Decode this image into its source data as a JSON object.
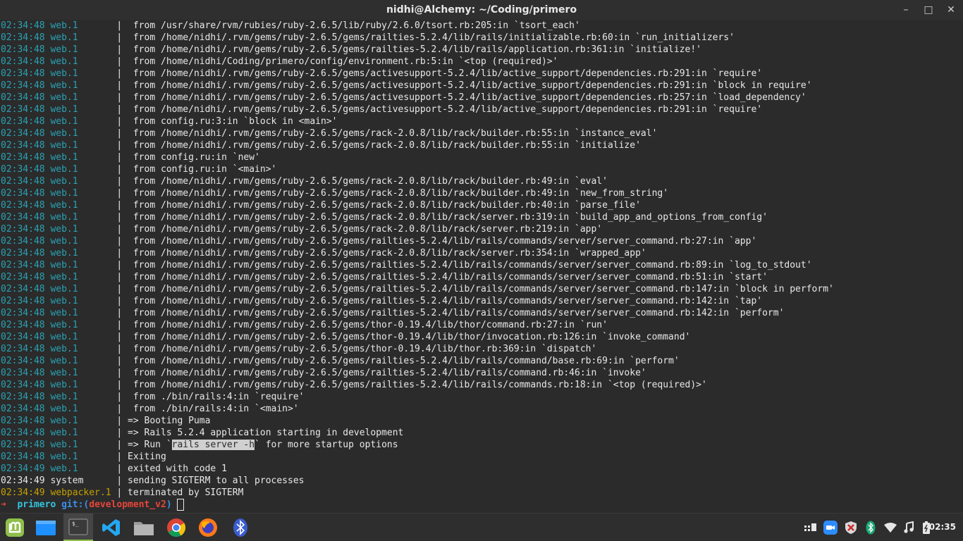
{
  "window": {
    "title": "nidhi@Alchemy: ~/Coding/primero",
    "controls": {
      "minimize": "–",
      "maximize": "□",
      "close": "✕"
    }
  },
  "terminal": {
    "lines": [
      {
        "ts": "02:34:48 web.1",
        "proc": "web",
        "sep": "       |  ",
        "text": "from /usr/share/rvm/rubies/ruby-2.6.5/lib/ruby/2.6.0/tsort.rb:205:in `tsort_each'"
      },
      {
        "ts": "02:34:48 web.1",
        "proc": "web",
        "sep": "       |  ",
        "text": "from /home/nidhi/.rvm/gems/ruby-2.6.5/gems/railties-5.2.4/lib/rails/initializable.rb:60:in `run_initializers'"
      },
      {
        "ts": "02:34:48 web.1",
        "proc": "web",
        "sep": "       |  ",
        "text": "from /home/nidhi/.rvm/gems/ruby-2.6.5/gems/railties-5.2.4/lib/rails/application.rb:361:in `initialize!'"
      },
      {
        "ts": "02:34:48 web.1",
        "proc": "web",
        "sep": "       |  ",
        "text": "from /home/nidhi/Coding/primero/config/environment.rb:5:in `<top (required)>'"
      },
      {
        "ts": "02:34:48 web.1",
        "proc": "web",
        "sep": "       |  ",
        "text": "from /home/nidhi/.rvm/gems/ruby-2.6.5/gems/activesupport-5.2.4/lib/active_support/dependencies.rb:291:in `require'"
      },
      {
        "ts": "02:34:48 web.1",
        "proc": "web",
        "sep": "       |  ",
        "text": "from /home/nidhi/.rvm/gems/ruby-2.6.5/gems/activesupport-5.2.4/lib/active_support/dependencies.rb:291:in `block in require'"
      },
      {
        "ts": "02:34:48 web.1",
        "proc": "web",
        "sep": "       |  ",
        "text": "from /home/nidhi/.rvm/gems/ruby-2.6.5/gems/activesupport-5.2.4/lib/active_support/dependencies.rb:257:in `load_dependency'"
      },
      {
        "ts": "02:34:48 web.1",
        "proc": "web",
        "sep": "       |  ",
        "text": "from /home/nidhi/.rvm/gems/ruby-2.6.5/gems/activesupport-5.2.4/lib/active_support/dependencies.rb:291:in `require'"
      },
      {
        "ts": "02:34:48 web.1",
        "proc": "web",
        "sep": "       |  ",
        "text": "from config.ru:3:in `block in <main>'"
      },
      {
        "ts": "02:34:48 web.1",
        "proc": "web",
        "sep": "       |  ",
        "text": "from /home/nidhi/.rvm/gems/ruby-2.6.5/gems/rack-2.0.8/lib/rack/builder.rb:55:in `instance_eval'"
      },
      {
        "ts": "02:34:48 web.1",
        "proc": "web",
        "sep": "       |  ",
        "text": "from /home/nidhi/.rvm/gems/ruby-2.6.5/gems/rack-2.0.8/lib/rack/builder.rb:55:in `initialize'"
      },
      {
        "ts": "02:34:48 web.1",
        "proc": "web",
        "sep": "       |  ",
        "text": "from config.ru:in `new'"
      },
      {
        "ts": "02:34:48 web.1",
        "proc": "web",
        "sep": "       |  ",
        "text": "from config.ru:in `<main>'"
      },
      {
        "ts": "02:34:48 web.1",
        "proc": "web",
        "sep": "       |  ",
        "text": "from /home/nidhi/.rvm/gems/ruby-2.6.5/gems/rack-2.0.8/lib/rack/builder.rb:49:in `eval'"
      },
      {
        "ts": "02:34:48 web.1",
        "proc": "web",
        "sep": "       |  ",
        "text": "from /home/nidhi/.rvm/gems/ruby-2.6.5/gems/rack-2.0.8/lib/rack/builder.rb:49:in `new_from_string'"
      },
      {
        "ts": "02:34:48 web.1",
        "proc": "web",
        "sep": "       |  ",
        "text": "from /home/nidhi/.rvm/gems/ruby-2.6.5/gems/rack-2.0.8/lib/rack/builder.rb:40:in `parse_file'"
      },
      {
        "ts": "02:34:48 web.1",
        "proc": "web",
        "sep": "       |  ",
        "text": "from /home/nidhi/.rvm/gems/ruby-2.6.5/gems/rack-2.0.8/lib/rack/server.rb:319:in `build_app_and_options_from_config'"
      },
      {
        "ts": "02:34:48 web.1",
        "proc": "web",
        "sep": "       |  ",
        "text": "from /home/nidhi/.rvm/gems/ruby-2.6.5/gems/rack-2.0.8/lib/rack/server.rb:219:in `app'"
      },
      {
        "ts": "02:34:48 web.1",
        "proc": "web",
        "sep": "       |  ",
        "text": "from /home/nidhi/.rvm/gems/ruby-2.6.5/gems/railties-5.2.4/lib/rails/commands/server/server_command.rb:27:in `app'"
      },
      {
        "ts": "02:34:48 web.1",
        "proc": "web",
        "sep": "       |  ",
        "text": "from /home/nidhi/.rvm/gems/ruby-2.6.5/gems/rack-2.0.8/lib/rack/server.rb:354:in `wrapped_app'"
      },
      {
        "ts": "02:34:48 web.1",
        "proc": "web",
        "sep": "       |  ",
        "text": "from /home/nidhi/.rvm/gems/ruby-2.6.5/gems/railties-5.2.4/lib/rails/commands/server/server_command.rb:89:in `log_to_stdout'"
      },
      {
        "ts": "02:34:48 web.1",
        "proc": "web",
        "sep": "       |  ",
        "text": "from /home/nidhi/.rvm/gems/ruby-2.6.5/gems/railties-5.2.4/lib/rails/commands/server/server_command.rb:51:in `start'"
      },
      {
        "ts": "02:34:48 web.1",
        "proc": "web",
        "sep": "       |  ",
        "text": "from /home/nidhi/.rvm/gems/ruby-2.6.5/gems/railties-5.2.4/lib/rails/commands/server/server_command.rb:147:in `block in perform'"
      },
      {
        "ts": "02:34:48 web.1",
        "proc": "web",
        "sep": "       |  ",
        "text": "from /home/nidhi/.rvm/gems/ruby-2.6.5/gems/railties-5.2.4/lib/rails/commands/server/server_command.rb:142:in `tap'"
      },
      {
        "ts": "02:34:48 web.1",
        "proc": "web",
        "sep": "       |  ",
        "text": "from /home/nidhi/.rvm/gems/ruby-2.6.5/gems/railties-5.2.4/lib/rails/commands/server/server_command.rb:142:in `perform'"
      },
      {
        "ts": "02:34:48 web.1",
        "proc": "web",
        "sep": "       |  ",
        "text": "from /home/nidhi/.rvm/gems/ruby-2.6.5/gems/thor-0.19.4/lib/thor/command.rb:27:in `run'"
      },
      {
        "ts": "02:34:48 web.1",
        "proc": "web",
        "sep": "       |  ",
        "text": "from /home/nidhi/.rvm/gems/ruby-2.6.5/gems/thor-0.19.4/lib/thor/invocation.rb:126:in `invoke_command'"
      },
      {
        "ts": "02:34:48 web.1",
        "proc": "web",
        "sep": "       |  ",
        "text": "from /home/nidhi/.rvm/gems/ruby-2.6.5/gems/thor-0.19.4/lib/thor.rb:369:in `dispatch'"
      },
      {
        "ts": "02:34:48 web.1",
        "proc": "web",
        "sep": "       |  ",
        "text": "from /home/nidhi/.rvm/gems/ruby-2.6.5/gems/railties-5.2.4/lib/rails/command/base.rb:69:in `perform'"
      },
      {
        "ts": "02:34:48 web.1",
        "proc": "web",
        "sep": "       |  ",
        "text": "from /home/nidhi/.rvm/gems/ruby-2.6.5/gems/railties-5.2.4/lib/rails/command.rb:46:in `invoke'"
      },
      {
        "ts": "02:34:48 web.1",
        "proc": "web",
        "sep": "       |  ",
        "text": "from /home/nidhi/.rvm/gems/ruby-2.6.5/gems/railties-5.2.4/lib/rails/commands.rb:18:in `<top (required)>'"
      },
      {
        "ts": "02:34:48 web.1",
        "proc": "web",
        "sep": "       |  ",
        "text": "from ./bin/rails:4:in `require'"
      },
      {
        "ts": "02:34:48 web.1",
        "proc": "web",
        "sep": "       |  ",
        "text": "from ./bin/rails:4:in `<main>'"
      },
      {
        "ts": "02:34:48 web.1",
        "proc": "web",
        "sep": "       | ",
        "text": "=> Booting Puma"
      },
      {
        "ts": "02:34:48 web.1",
        "proc": "web",
        "sep": "       | ",
        "text": "=> Rails 5.2.4 application starting in development"
      },
      {
        "ts": "02:34:48 web.1",
        "proc": "web",
        "sep": "       | ",
        "text": "=> Run `",
        "hl": "rails server -h",
        "after": "` for more startup options"
      },
      {
        "ts": "02:34:48 web.1",
        "proc": "web",
        "sep": "       | ",
        "text": "Exiting"
      },
      {
        "ts": "02:34:49 web.1",
        "proc": "web",
        "sep": "       | ",
        "text": "exited with code 1"
      },
      {
        "ts": "02:34:49 system",
        "proc": "sys",
        "sep": "      | ",
        "text": "sending SIGTERM to all processes"
      },
      {
        "ts": "02:34:49 webpacker.1",
        "proc": "wp",
        "sep": " | ",
        "text": "terminated by SIGTERM"
      }
    ],
    "prompt": {
      "arrow": "➜",
      "dir": "primero",
      "git_label": "git:(",
      "branch": "development_v2",
      "git_close": ")"
    }
  },
  "taskbar": {
    "apps": [
      {
        "name": "mint-menu",
        "label": "Menu"
      },
      {
        "name": "show-desktop",
        "label": "Show Desktop"
      },
      {
        "name": "terminal",
        "label": "Terminal",
        "active": true
      },
      {
        "name": "vscode",
        "label": "Visual Studio Code"
      },
      {
        "name": "files",
        "label": "Files"
      },
      {
        "name": "chrome",
        "label": "Google Chrome"
      },
      {
        "name": "firefox",
        "label": "Firefox"
      },
      {
        "name": "bluetooth",
        "label": "Bluetooth"
      }
    ],
    "clock": "02:35",
    "colors": {
      "mint": "#8fbf4b",
      "folder": "#1e90ff",
      "vscode": "#23a8f2",
      "chrome_red": "#db4437",
      "chrome_yellow": "#f4c20d",
      "chrome_green": "#0f9d58",
      "chrome_blue": "#4285f4",
      "firefox": "#ff7a1a",
      "bluetooth": "#3b5ccf"
    }
  }
}
